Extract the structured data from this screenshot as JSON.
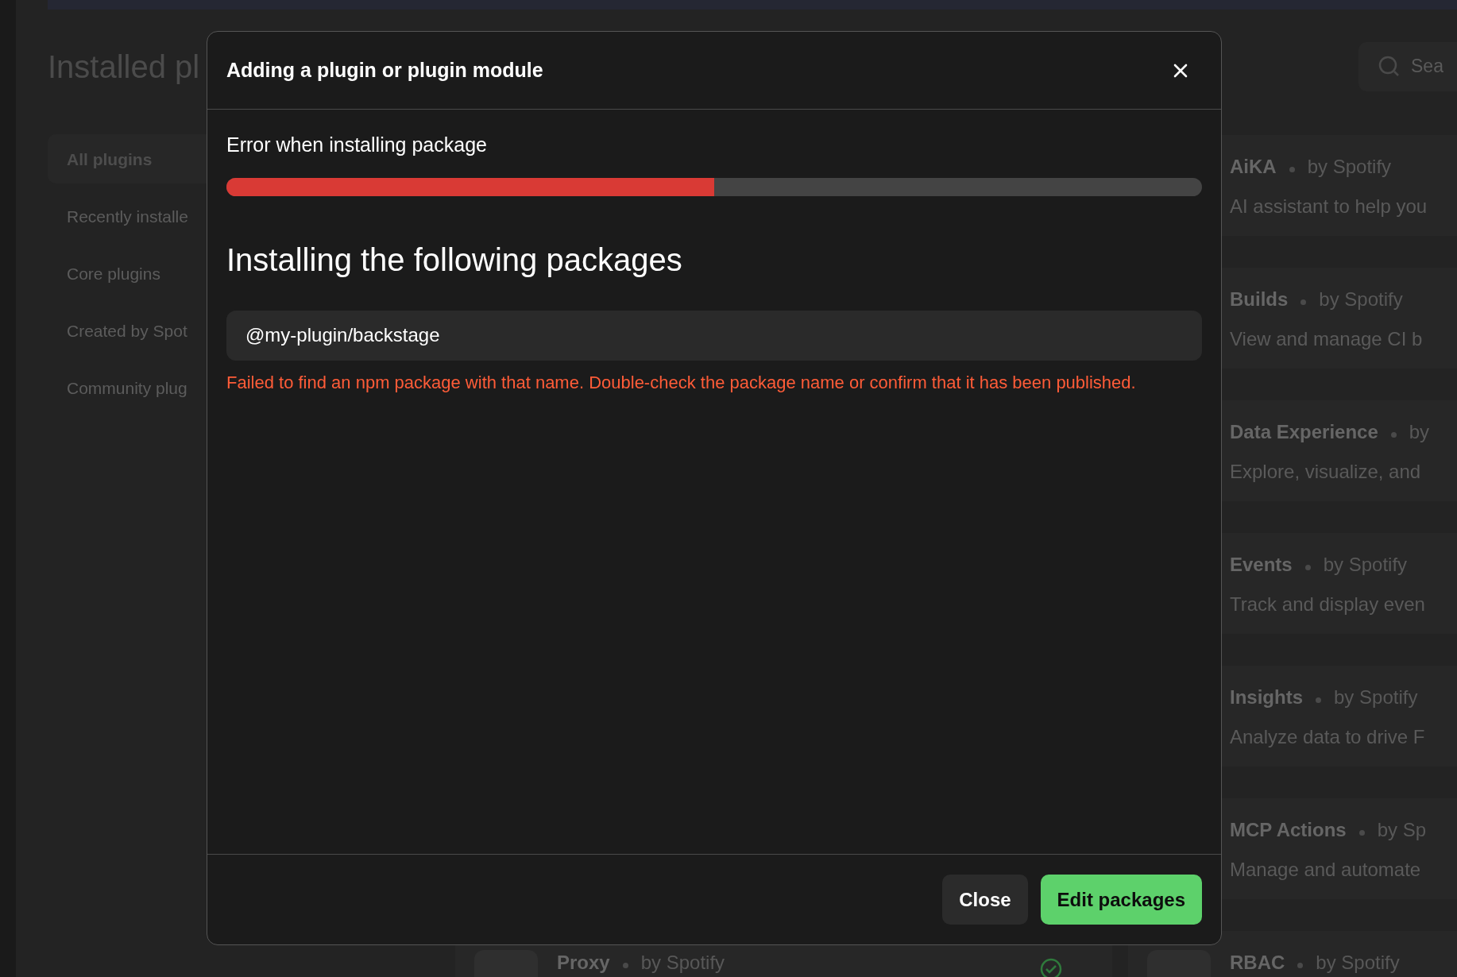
{
  "page": {
    "title": "Installed pl",
    "search": {
      "placeholder": "Sea"
    }
  },
  "sidebar": {
    "items": [
      {
        "label": "All plugins",
        "selected": true
      },
      {
        "label": "Recently installe",
        "selected": false
      },
      {
        "label": "Core plugins",
        "selected": false
      },
      {
        "label": "Created by Spot",
        "selected": false
      },
      {
        "label": "Community plug",
        "selected": false
      }
    ]
  },
  "plugin_rows": [
    {
      "right": {
        "name": "AiKA",
        "author": "by Spotify",
        "description": "AI assistant to help you",
        "has_icon": false
      }
    },
    {
      "right": {
        "name": "Builds",
        "author": "by Spotify",
        "description": "View and manage CI b",
        "has_icon": false
      }
    },
    {
      "right": {
        "name": "Data Experience",
        "author": "by",
        "description": "Explore, visualize, and",
        "has_icon": false
      }
    },
    {
      "right": {
        "name": "Events",
        "author": "by Spotify",
        "description": "Track and display even",
        "has_icon": false
      }
    },
    {
      "right": {
        "name": "Insights",
        "author": "by Spotify",
        "description": "Analyze data to drive F",
        "has_icon": false
      }
    },
    {
      "right": {
        "name": "MCP Actions",
        "author": "by Sp",
        "description": "Manage and automate",
        "has_icon": false
      }
    },
    {
      "left": {
        "name": "Proxy",
        "author": "by Spotify",
        "has_icon": true,
        "installed": true
      },
      "right": {
        "name": "RBAC",
        "author": "by Spotify",
        "has_icon": true
      }
    }
  ],
  "dialog": {
    "title": "Adding a plugin or plugin module",
    "status": "Error when installing package",
    "progress": {
      "level": 0.5
    },
    "heading": "Installing the following packages",
    "package_field": {
      "value": "@my-plugin/backstage"
    },
    "error": "Failed to find an npm package with that name. Double-check the package name or confirm that it has been published.",
    "buttons": [
      {
        "label": "Close",
        "kind": "secondary"
      },
      {
        "label": "Edit packages",
        "kind": "primary"
      }
    ]
  }
}
